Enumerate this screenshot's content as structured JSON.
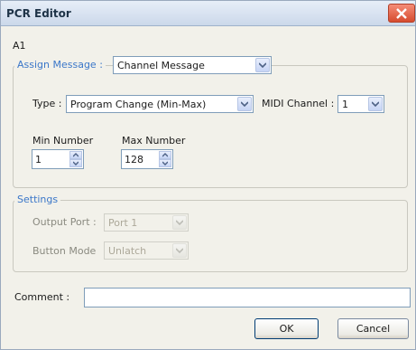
{
  "window": {
    "title": "PCR Editor",
    "close_icon": "close-icon"
  },
  "control_id": "A1",
  "assign": {
    "legend": "Assign Message :",
    "message_value": "Channel Message",
    "type_label": "Type :",
    "type_value": "Program Change (Min-Max)",
    "channel_label": "MIDI Channel :",
    "channel_value": "1",
    "min_label": "Min Number",
    "min_value": "1",
    "max_label": "Max Number",
    "max_value": "128"
  },
  "settings": {
    "legend": "Settings",
    "output_port_label": "Output Port :",
    "output_port_value": "Port 1",
    "button_mode_label": "Button Mode",
    "button_mode_value": "Unlatch"
  },
  "comment": {
    "label": "Comment :",
    "value": ""
  },
  "buttons": {
    "ok": "OK",
    "cancel": "Cancel"
  },
  "colors": {
    "legend": "#3b77c9",
    "dialog_bg": "#f2f1ea",
    "close_button": "#d64b2e"
  }
}
